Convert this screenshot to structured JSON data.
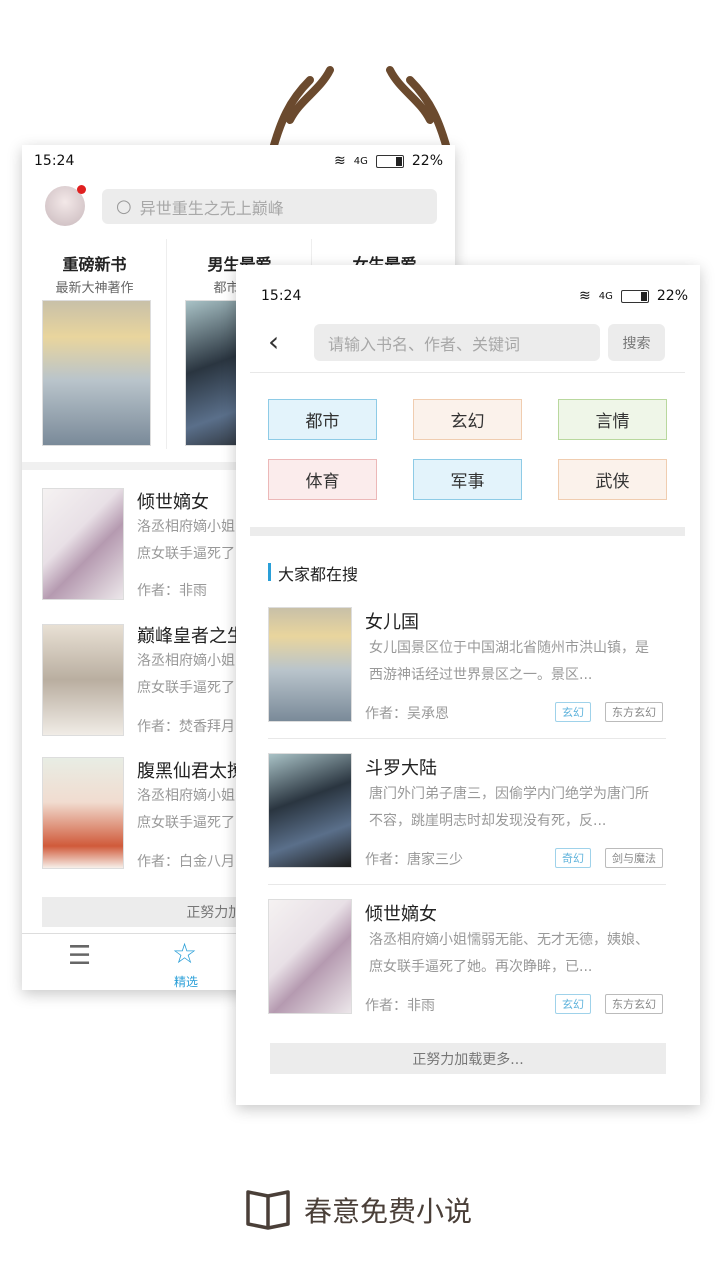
{
  "back_screen": {
    "status": {
      "time": "15:24",
      "network": "4G",
      "battery": "22%"
    },
    "search_placeholder": "异世重生之无上巅峰",
    "columns": [
      {
        "title": "重磅新书",
        "subtitle": "最新大神著作"
      },
      {
        "title": "男生最爱",
        "subtitle": "都市玄幻"
      },
      {
        "title": "女生最爱",
        "subtitle": ""
      }
    ],
    "books": [
      {
        "title": "倾世嫡女",
        "desc1": "洛丞相府嫡小姐",
        "desc2": "庶女联手逼死了",
        "author": "作者：非雨"
      },
      {
        "title": "巅峰皇者之生",
        "desc1": "洛丞相府嫡小姐",
        "desc2": "庶女联手逼死了",
        "author": "作者：焚香拜月"
      },
      {
        "title": "腹黑仙君太撩",
        "desc1": "洛丞相府嫡小姐",
        "desc2": "庶女联手逼死了",
        "author": "作者：白金八月"
      }
    ],
    "load_more": "正努力加载更多...",
    "nav": {
      "active_label": "精选"
    }
  },
  "front_screen": {
    "status": {
      "time": "15:24",
      "network": "4G",
      "battery": "22%"
    },
    "search_placeholder": "请输入书名、作者、关键词",
    "search_button": "搜索",
    "categories": [
      {
        "label": "都市",
        "bg": "#e3f3fb",
        "border": "#8ecbe6"
      },
      {
        "label": "玄幻",
        "bg": "#fbf2eb",
        "border": "#f0cdb0"
      },
      {
        "label": "言情",
        "bg": "#eff6e8",
        "border": "#b9d89e"
      },
      {
        "label": "体育",
        "bg": "#fbecec",
        "border": "#ecb8b8"
      },
      {
        "label": "军事",
        "bg": "#e3f3fb",
        "border": "#8ecbe6"
      },
      {
        "label": "武侠",
        "bg": "#fbf2eb",
        "border": "#f0cdb0"
      }
    ],
    "section_title": "大家都在搜",
    "books": [
      {
        "title": "女儿国",
        "desc1": "女儿国景区位于中国湖北省随州市洪山镇，是",
        "desc2": "西游神话经过世界景区之一。景区...",
        "author": "作者：吴承恩",
        "tags": [
          "玄幻",
          "东方玄幻"
        ]
      },
      {
        "title": "斗罗大陆",
        "desc1": "唐门外门弟子唐三，因偷学内门绝学为唐门所",
        "desc2": "不容，跳崖明志时却发现没有死，反...",
        "author": "作者：唐家三少",
        "tags": [
          "奇幻",
          "剑与魔法"
        ]
      },
      {
        "title": "倾世嫡女",
        "desc1": "洛丞相府嫡小姐懦弱无能、无才无德，姨娘、",
        "desc2": "庶女联手逼死了她。再次睁眸，已...",
        "author": "作者：非雨",
        "tags": [
          "玄幻",
          "东方玄幻"
        ]
      }
    ],
    "load_more": "正努力加载更多..."
  },
  "brand": {
    "name": "春意免费小说"
  },
  "colors": {
    "accent": "#2a9fd8",
    "brand_text": "#4a3f38"
  }
}
